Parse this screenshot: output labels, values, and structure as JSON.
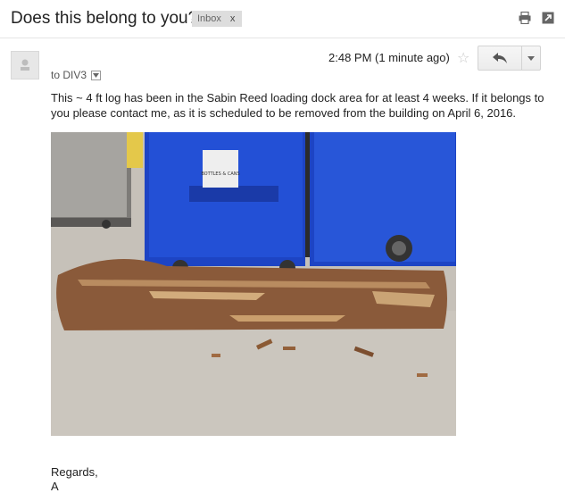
{
  "email": {
    "subject": "Does this belong to you?",
    "label": "Inbox",
    "label_remove": "x",
    "recipient": "to DIV3",
    "timestamp": "2:48 PM (1 minute ago)",
    "body": "This ~ 4 ft log has been in the Sabin Reed loading dock area for at least 4 weeks.  If it belongs to you please contact me, as it is scheduled to be removed from the building on April 6, 2016.",
    "closing": "Regards,",
    "signature": "A"
  },
  "icons": {
    "print": "print-icon",
    "new_window": "open-in-new-window-icon",
    "avatar": "person-avatar-icon",
    "recipient_dropdown": "dropdown-arrow-icon",
    "star": "star-outline-icon",
    "reply": "reply-arrow-icon",
    "more": "more-options-caret-icon"
  },
  "photo": {
    "label_text": "BOTTLES & CANS",
    "description_colors": {
      "bins": "#1f47c9",
      "floor": "#c9c4bd",
      "log": "#8a5a3a"
    }
  }
}
